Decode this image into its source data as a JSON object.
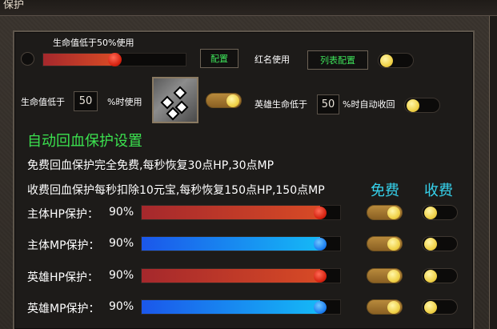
{
  "window": {
    "title": "保护"
  },
  "top": {
    "hp_threshold_label": "生命值低于50%使用",
    "hp_threshold_slider": {
      "value_percent": 50
    },
    "config_button": "配置",
    "red_name_label": "红名使用",
    "list_config_button": "列表配置",
    "red_name_toggle": {
      "on": false
    }
  },
  "skill_row": {
    "hp_below_label": "生命值低于",
    "hp_below_value": "50",
    "hp_percent_use_label": "%时使用",
    "skill_toggle": {
      "on": true
    },
    "hero_hp_below_label": "英雄生命低于",
    "hero_hp_value": "50",
    "hero_recall_label": "%时自动收回",
    "hero_toggle": {
      "on": false
    }
  },
  "recovery": {
    "title": "自动回血保护设置",
    "free_desc": "免费回血保护完全免费,每秒恢复30点HP,30点MP",
    "paid_desc": "收费回血保护每秒扣除10元宝,每秒恢复150点HP,150点MP",
    "col_free": "免费",
    "col_paid": "收费",
    "rows": [
      {
        "label": "主体HP保护：",
        "value": "90%",
        "percent": 90,
        "kind": "hp",
        "free_on": true,
        "paid_on": false
      },
      {
        "label": "主体MP保护：",
        "value": "90%",
        "percent": 90,
        "kind": "mp",
        "free_on": true,
        "paid_on": false
      },
      {
        "label": "英雄HP保护：",
        "value": "90%",
        "percent": 90,
        "kind": "hp",
        "free_on": true,
        "paid_on": false
      },
      {
        "label": "英雄MP保护：",
        "value": "90%",
        "percent": 90,
        "kind": "mp",
        "free_on": true,
        "paid_on": false
      }
    ]
  },
  "colors": {
    "green_text": "#3be24f",
    "cyan_header": "#36d4ee",
    "hp_bar": "#c9392a",
    "mp_bar": "#1a86f0"
  }
}
